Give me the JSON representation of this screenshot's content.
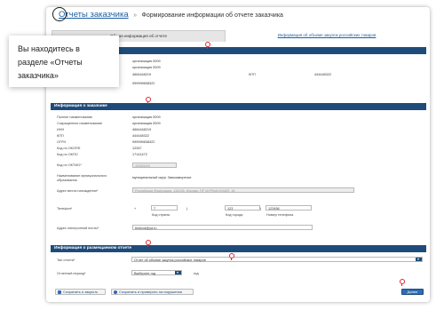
{
  "breadcrumb": {
    "home_label": "Отчеты заказчика",
    "separator": "»",
    "current": "Формирование информации об отчете заказчика"
  },
  "tabs": [
    {
      "label": "Общая информация об отчете",
      "active": true
    },
    {
      "label": "Информация об объеме закупок российских товаров",
      "active": false
    }
  ],
  "callout": {
    "text": "Вы находитесь в разделе «Отчеты заказчика»"
  },
  "sections": {
    "placed_report": "...размещенный отчет",
    "customer_info": "Информация о заказчике",
    "placing_info": "Информация о размещаемом отчете"
  },
  "placed_report": {
    "line1": "организация 0009",
    "line2": "организация 0009",
    "inn": "4664448219",
    "kpp_label": "КПП",
    "kpp": "444448322",
    "ogrn": "999999838322"
  },
  "customer": {
    "fields": [
      {
        "label": "Полное наименование",
        "value": "организация 0009"
      },
      {
        "label": "Сокращенное наименование",
        "value": "организация 0009"
      },
      {
        "label": "ИНН",
        "value": "4664448219"
      },
      {
        "label": "КПП",
        "value": "444448322"
      },
      {
        "label": "ОГРН",
        "value": "999999838322"
      },
      {
        "label": "Код по ОКОПФ",
        "value": "12267"
      },
      {
        "label": "Код по ОКПО",
        "value": "17141472"
      }
    ],
    "oktmo_label": "Код по ОКТМО*",
    "oktmo_value": "45383000",
    "municipal_label": "Наименование муниципального образования",
    "municipal_value": "муниципальный округ Замоскворечье",
    "address_label": "Адрес места нахождения*",
    "address_value": "Российская Федерация, 115035, Москва, ПР МУРМАНСКИЙ, 16",
    "phone_label": "Телефон*",
    "phone_plus": "+",
    "phone_country": "7",
    "phone_country_label": "Код страны",
    "phone_open": "(",
    "phone_city": "123",
    "phone_city_label": "Код города",
    "phone_close": ")",
    "phone_number": "123456",
    "phone_number_label": "Номер телефона",
    "email_label": "Адрес электронной почты*",
    "email_value": "testova@ya.ru"
  },
  "report": {
    "type_label": "Тип отчета*",
    "type_value": "Отчет об объеме закупок российских товаров",
    "period_label": "Отчетный период*",
    "period_value": "Выберите год",
    "year_suffix": "год"
  },
  "buttons": {
    "save_close": "Сохранить и закрыть",
    "save_check": "Сохранить и проверить на нарушения",
    "next": "Далее"
  },
  "colors": {
    "header_blue": "#1f4b7a",
    "link_blue": "#1d5fa3",
    "marker_red": "#e8222f"
  }
}
